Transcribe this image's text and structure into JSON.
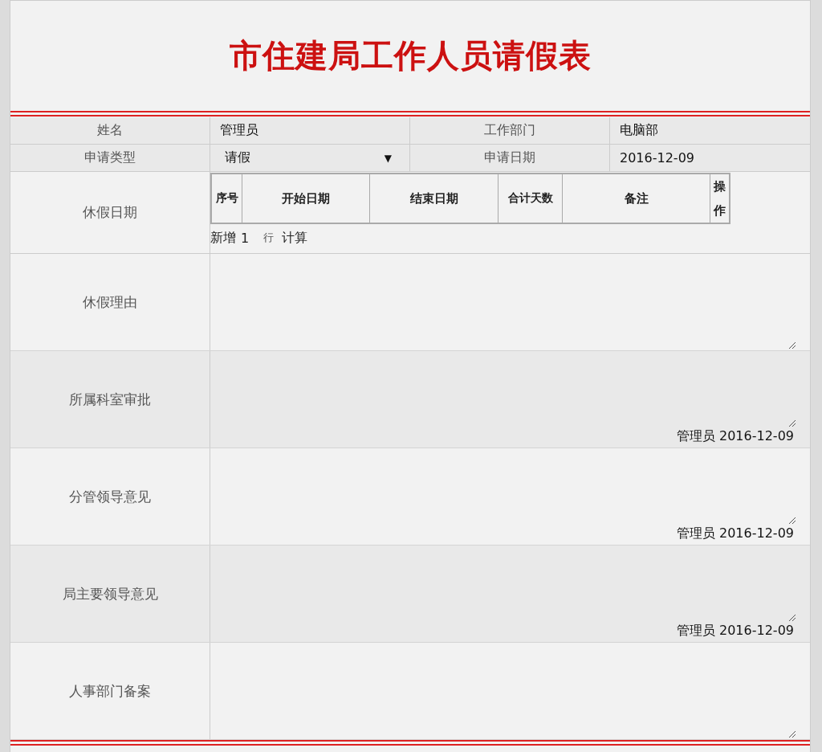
{
  "title": "市住建局工作人员请假表",
  "info_rows": [
    {
      "fields": [
        {
          "label": "姓名",
          "value": "管理员",
          "kind": "text"
        },
        {
          "label": "工作部门",
          "value": "电脑部",
          "kind": "text"
        }
      ]
    },
    {
      "fields": [
        {
          "label": "申请类型",
          "value": "请假",
          "kind": "select",
          "caret": "▼"
        },
        {
          "label": "申请日期",
          "value": "2016-12-09",
          "kind": "text"
        }
      ]
    }
  ],
  "leave_dates": {
    "label": "休假日期",
    "columns": [
      "序号",
      "开始日期",
      "结束日期",
      "合计天数",
      "备注",
      "操作"
    ],
    "add_label": "新增",
    "add_count": "1",
    "add_unit": "行",
    "calc_button": "计算"
  },
  "sections": [
    {
      "label": "休假理由"
    },
    {
      "label": "所属科室审批",
      "signature": "管理员 2016-12-09"
    },
    {
      "label": "分管领导意见",
      "signature": "管理员 2016-12-09"
    },
    {
      "label": "局主要领导意见",
      "signature": "管理员 2016-12-09"
    },
    {
      "label": "人事部门备案"
    }
  ]
}
